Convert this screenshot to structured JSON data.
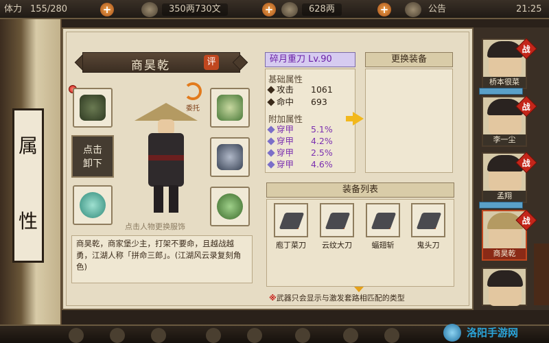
{
  "topbar": {
    "stamina_label": "体力",
    "stamina": "155/280",
    "coins": "350两730文",
    "gold": "628两",
    "notice": "公告",
    "time": "21:25"
  },
  "scroll": {
    "glyphs": [
      "属",
      "性"
    ]
  },
  "character": {
    "name": "商昊乾",
    "rate_label": "评",
    "entrust_label": "委托",
    "unequip_label_1": "点击",
    "unequip_label_2": "卸下",
    "click_hint": "点击人物更换服饰",
    "description": "商昊乾，商家堡少主，打架不要命，且越战越勇，江湖人称「拼命三郎」。(江湖风云录复刻角色)"
  },
  "weapon": {
    "title": "碎月重刀 Lv.90",
    "base_header": "基础属性",
    "base": [
      {
        "label": "攻击",
        "value": "1061"
      },
      {
        "label": "命中",
        "value": "693"
      }
    ],
    "extra_header": "附加属性",
    "extra": [
      {
        "label": "穿甲",
        "value": "5.1%"
      },
      {
        "label": "穿甲",
        "value": "4.2%"
      },
      {
        "label": "穿甲",
        "value": "2.5%"
      },
      {
        "label": "穿甲",
        "value": "4.6%"
      }
    ]
  },
  "swap": {
    "title": "更换装备"
  },
  "equip_list": {
    "title": "装备列表",
    "items": [
      {
        "name": "庖丁菜刀"
      },
      {
        "name": "云纹大刀"
      },
      {
        "name": "蝠翅斩"
      },
      {
        "name": "鬼头刀"
      }
    ],
    "note_mark": "※",
    "note": "武器只会显示与激发套路相匹配的类型"
  },
  "roster": {
    "battle_label": "战",
    "heroes": [
      {
        "name": "桥本很菜"
      },
      {
        "name": "李一尘"
      },
      {
        "name": "孟翔"
      },
      {
        "name": "商昊乾"
      },
      {
        "name": ""
      }
    ]
  },
  "watermark": "洛阳手游网"
}
